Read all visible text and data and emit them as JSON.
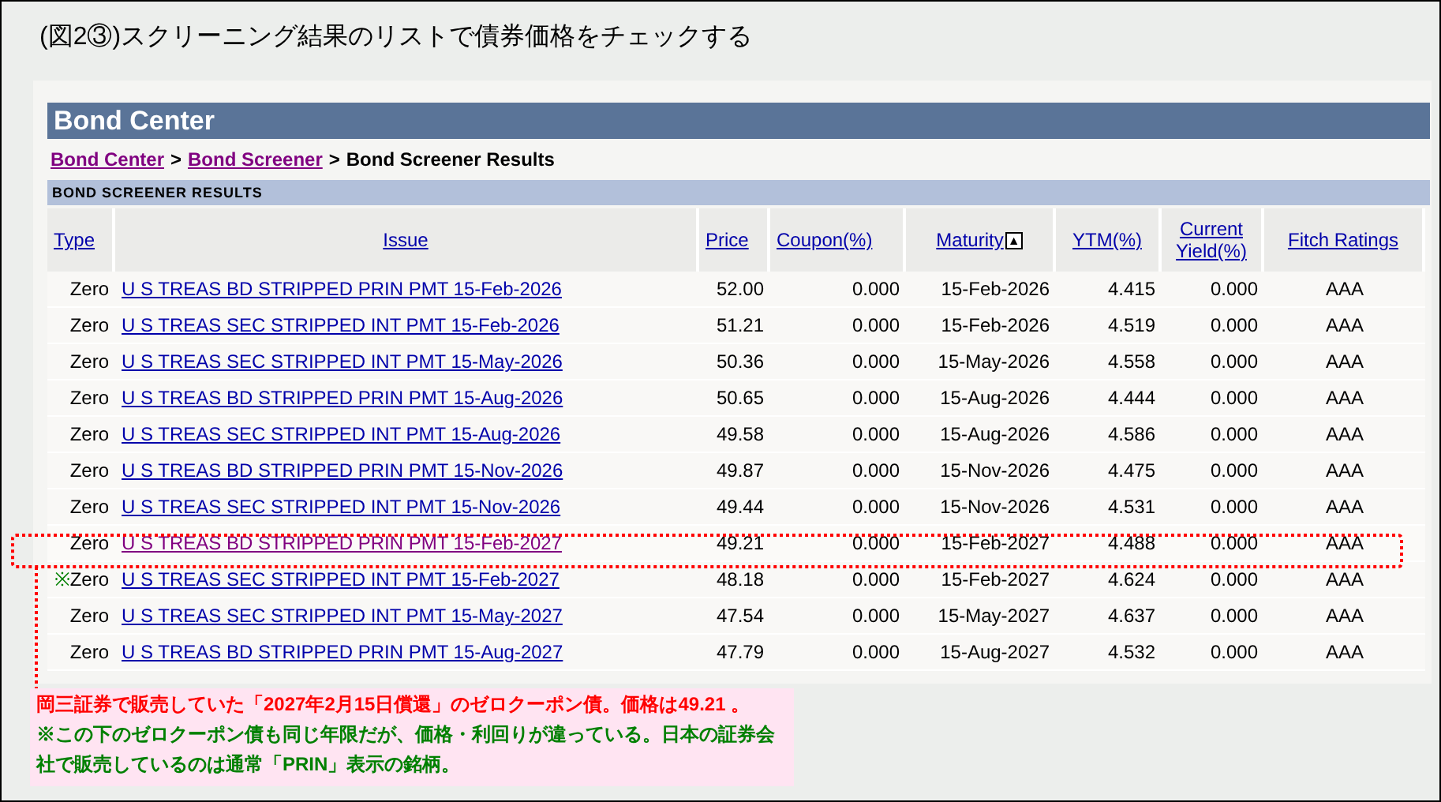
{
  "caption": "(図2③)スクリーニング結果のリストで債券価格をチェックする",
  "header": {
    "title": "Bond Center"
  },
  "breadcrumb": [
    {
      "label": "Bond Center",
      "link": true
    },
    {
      "label": "Bond Screener",
      "link": true
    },
    {
      "label": "Bond Screener Results",
      "link": false
    }
  ],
  "breadcrumb_separator": ">",
  "section_title": "BOND SCREENER RESULTS",
  "table": {
    "columns": [
      {
        "label": "Type"
      },
      {
        "label": "Issue"
      },
      {
        "label": "Price"
      },
      {
        "label": "Coupon(%)"
      },
      {
        "label": "Maturity",
        "sort": "▲"
      },
      {
        "label": "YTM(%)"
      },
      {
        "label": "Current Yield(%)"
      },
      {
        "label": "Fitch Ratings"
      }
    ],
    "rows": [
      {
        "type": "Zero",
        "issue": "U S TREAS BD STRIPPED PRIN PMT 15-Feb-2026",
        "price": "52.00",
        "coupon": "0.000",
        "maturity": "15-Feb-2026",
        "ytm": "4.415",
        "current_yield": "0.000",
        "rating": "AAA",
        "highlighted": false,
        "visited": false
      },
      {
        "type": "Zero",
        "issue": "U S TREAS SEC STRIPPED INT PMT 15-Feb-2026",
        "price": "51.21",
        "coupon": "0.000",
        "maturity": "15-Feb-2026",
        "ytm": "4.519",
        "current_yield": "0.000",
        "rating": "AAA",
        "highlighted": false,
        "visited": false
      },
      {
        "type": "Zero",
        "issue": "U S TREAS SEC STRIPPED INT PMT 15-May-2026",
        "price": "50.36",
        "coupon": "0.000",
        "maturity": "15-May-2026",
        "ytm": "4.558",
        "current_yield": "0.000",
        "rating": "AAA",
        "highlighted": false,
        "visited": false
      },
      {
        "type": "Zero",
        "issue": "U S TREAS BD STRIPPED PRIN PMT 15-Aug-2026",
        "price": "50.65",
        "coupon": "0.000",
        "maturity": "15-Aug-2026",
        "ytm": "4.444",
        "current_yield": "0.000",
        "rating": "AAA",
        "highlighted": false,
        "visited": false
      },
      {
        "type": "Zero",
        "issue": "U S TREAS SEC STRIPPED INT PMT 15-Aug-2026",
        "price": "49.58",
        "coupon": "0.000",
        "maturity": "15-Aug-2026",
        "ytm": "4.586",
        "current_yield": "0.000",
        "rating": "AAA",
        "highlighted": false,
        "visited": false
      },
      {
        "type": "Zero",
        "issue": "U S TREAS BD STRIPPED PRIN PMT 15-Nov-2026",
        "price": "49.87",
        "coupon": "0.000",
        "maturity": "15-Nov-2026",
        "ytm": "4.475",
        "current_yield": "0.000",
        "rating": "AAA",
        "highlighted": false,
        "visited": false
      },
      {
        "type": "Zero",
        "issue": "U S TREAS SEC STRIPPED INT PMT 15-Nov-2026",
        "price": "49.44",
        "coupon": "0.000",
        "maturity": "15-Nov-2026",
        "ytm": "4.531",
        "current_yield": "0.000",
        "rating": "AAA",
        "highlighted": false,
        "visited": false
      },
      {
        "type": "Zero",
        "issue": "U S TREAS BD STRIPPED PRIN PMT 15-Feb-2027",
        "price": "49.21",
        "coupon": "0.000",
        "maturity": "15-Feb-2027",
        "ytm": "4.488",
        "current_yield": "0.000",
        "rating": "AAA",
        "highlighted": true,
        "visited": true
      },
      {
        "mark": "※",
        "type": "Zero",
        "issue": "U S TREAS SEC STRIPPED INT PMT 15-Feb-2027",
        "price": "48.18",
        "coupon": "0.000",
        "maturity": "15-Feb-2027",
        "ytm": "4.624",
        "current_yield": "0.000",
        "rating": "AAA",
        "highlighted": false,
        "visited": false
      },
      {
        "type": "Zero",
        "issue": "U S TREAS SEC STRIPPED INT PMT 15-May-2027",
        "price": "47.54",
        "coupon": "0.000",
        "maturity": "15-May-2027",
        "ytm": "4.637",
        "current_yield": "0.000",
        "rating": "AAA",
        "highlighted": false,
        "visited": false
      },
      {
        "type": "Zero",
        "issue": "U S TREAS BD STRIPPED PRIN PMT 15-Aug-2027",
        "price": "47.79",
        "coupon": "0.000",
        "maturity": "15-Aug-2027",
        "ytm": "4.532",
        "current_yield": "0.000",
        "rating": "AAA",
        "highlighted": false,
        "visited": false
      }
    ]
  },
  "annotations": [
    {
      "text": "岡三証券で販売していた「2027年2月15日償還」のゼロクーポン債。価格は49.21 。",
      "color": "#ff0000"
    },
    {
      "text": "※この下のゼロクーポン債も同じ年限だが、価格・利回りが違っている。日本の証券会社で販売しているのは通常「PRIN」表示の銘柄。",
      "color": "#008000"
    }
  ]
}
